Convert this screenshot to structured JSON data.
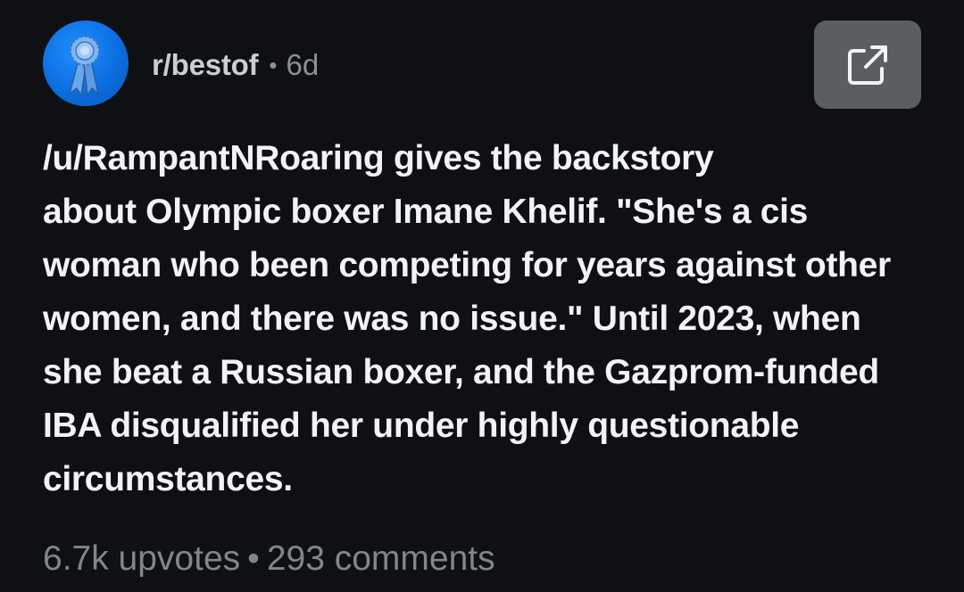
{
  "post": {
    "subreddit": "r/bestof",
    "separator": "•",
    "age": "6d",
    "title_lines": [
      "/u/RampantNRoaring gives the backstory",
      "about Olympic boxer Imane Khelif. \"She's a cis",
      "woman who been competing for years against other",
      "women, and there was no issue.\" Until 2023, when",
      "she beat a Russian boxer, and the Gazprom-funded",
      "IBA disqualified her under highly questionable",
      "circumstances."
    ],
    "upvotes": "6.7k upvotes",
    "stats_separator": "•",
    "comments": "293 comments"
  },
  "icons": {
    "avatar": "blue-ribbon-award-icon",
    "share": "external-link-icon"
  },
  "colors": {
    "background": "#0e1013",
    "avatar_blue": "#0b6ee0",
    "share_button": "#5a5d61",
    "muted_text": "#80868d"
  }
}
